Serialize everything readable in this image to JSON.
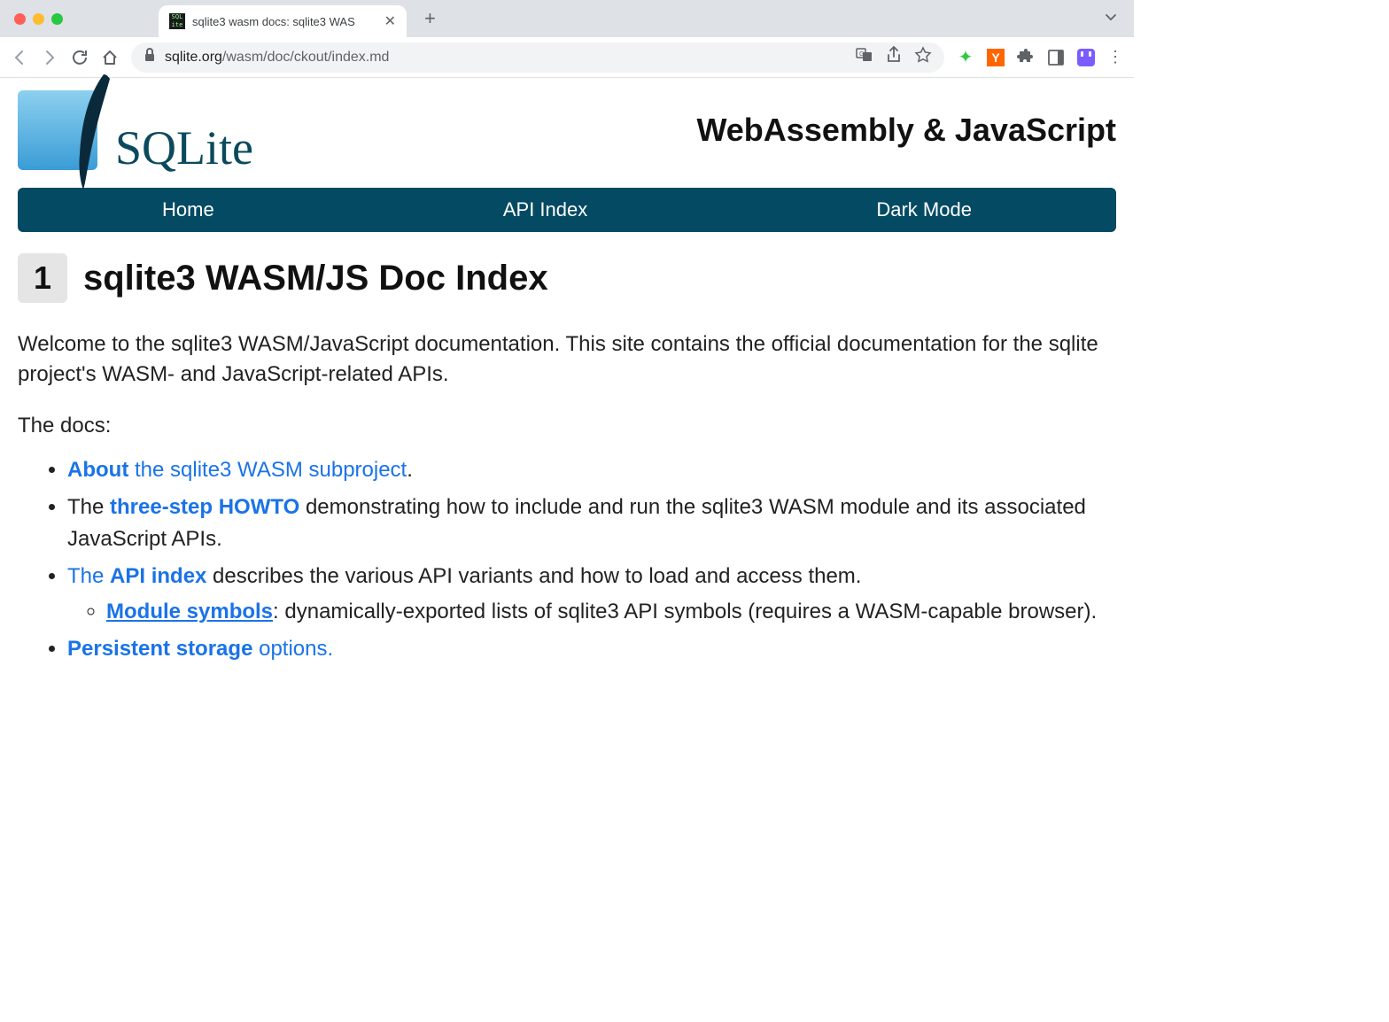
{
  "browser": {
    "tab_title": "sqlite3 wasm docs: sqlite3 WAS",
    "url_domain": "sqlite.org",
    "url_path": "/wasm/doc/ckout/index.md"
  },
  "header": {
    "logo_text": "SQLite",
    "title": "WebAssembly & JavaScript"
  },
  "navbar": {
    "home": "Home",
    "api_index": "API Index",
    "dark_mode": "Dark Mode"
  },
  "section": {
    "number": "1",
    "title": "sqlite3 WASM/JS Doc Index"
  },
  "intro": "Welcome to the sqlite3 WASM/JavaScript documentation. This site contains the official documentation for the sqlite project's WASM- and JavaScript-related APIs.",
  "docs_label": "The docs:",
  "items": {
    "about_bold": "About",
    "about_rest": " the sqlite3 WASM subproject",
    "howto_pre": "The ",
    "howto_link": "three-step HOWTO",
    "howto_post": " demonstrating how to include and run the sqlite3 WASM module and its associated JavaScript APIs.",
    "api_pre": "The ",
    "api_link": "API index",
    "api_post": " describes the various API variants and how to load and access them.",
    "symbols_link": "Module symbols",
    "symbols_post": ": dynamically-exported lists of sqlite3 API symbols (requires a WASM-capable browser).",
    "storage_link": "Persistent storage",
    "storage_post": " options."
  }
}
